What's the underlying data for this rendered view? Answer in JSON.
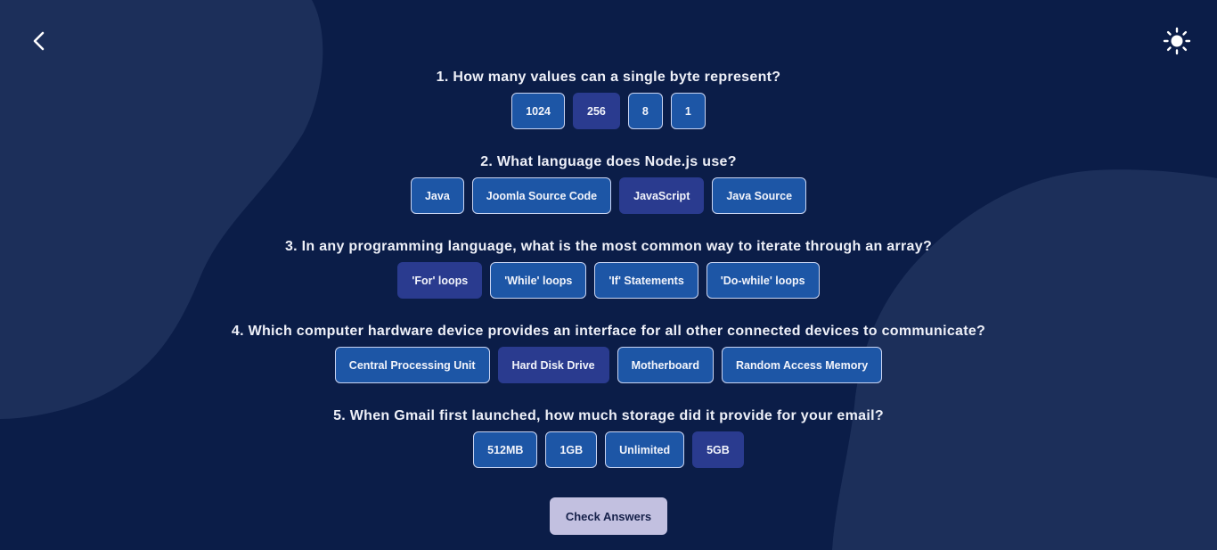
{
  "colors": {
    "background": "#0b1d48",
    "blob": "#1c2f5a",
    "option": "#1d56a6",
    "option_selected": "#2a3b8f",
    "check_button": "#c2c0e0"
  },
  "icons": {
    "back": "chevron-left-icon",
    "theme": "sun-icon"
  },
  "questions": [
    {
      "text": "1. How many values can a single byte represent?",
      "options": [
        "1024",
        "256",
        "8",
        "1"
      ],
      "selected": 1
    },
    {
      "text": "2. What language does Node.js use?",
      "options": [
        "Java",
        "Joomla Source Code",
        "JavaScript",
        "Java Source"
      ],
      "selected": 2
    },
    {
      "text": "3. In any programming language, what is the most common way to iterate through an array?",
      "options": [
        "'For' loops",
        "'While' loops",
        "'If' Statements",
        "'Do-while' loops"
      ],
      "selected": 0
    },
    {
      "text": "4. Which computer hardware device provides an interface for all other connected devices to communicate?",
      "options": [
        "Central Processing Unit",
        "Hard Disk Drive",
        "Motherboard",
        "Random Access Memory"
      ],
      "selected": 1
    },
    {
      "text": "5. When Gmail first launched, how much storage did it provide for your email?",
      "options": [
        "512MB",
        "1GB",
        "Unlimited",
        "5GB"
      ],
      "selected": 3
    }
  ],
  "check_button_label": "Check Answers"
}
